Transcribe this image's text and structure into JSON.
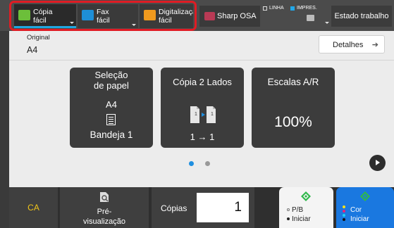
{
  "top_tabs": [
    {
      "label_line1": "Cópia",
      "label_line2": "fácil",
      "icon": "copy-icon"
    },
    {
      "label_line1": "Fax",
      "label_line2": "fácil",
      "icon": "fax-icon"
    },
    {
      "label_line1": "Digitalização",
      "label_line2": "fácil",
      "icon": "scan-icon"
    }
  ],
  "sharp_osa": {
    "label": "Sharp OSA",
    "icon": "osa-icon"
  },
  "status": {
    "line_label": "LINHA",
    "print_label": "IMPRES."
  },
  "job_status_label": "Estado trabalho",
  "original": {
    "label": "Original",
    "value": "A4"
  },
  "details_label": "Detalhes",
  "cards": {
    "paper": {
      "title_line1": "Seleção",
      "title_line2": "de papel",
      "size": "A4",
      "tray": "Bandeja 1"
    },
    "duplex": {
      "title": "Cópia 2 Lados",
      "value": "1 → 1"
    },
    "scale": {
      "title": "Escalas A/R",
      "value": "100%"
    }
  },
  "pagination": {
    "current_page": 1,
    "total_pages": 2
  },
  "bottom": {
    "ca_label": "CA",
    "preview_line1": "Pré-",
    "preview_line2": "visualização",
    "copies_label": "Cópias",
    "copies_value": "1",
    "bw_line1": "P/B",
    "bw_line2": "Iniciar",
    "color_line1": "Cor",
    "color_line2": "Iniciar"
  },
  "colors": {
    "accent_blue": "#1a78e0",
    "highlight_red": "#e01c24",
    "ca_yellow": "#f0c419",
    "start_green": "#2fb84a"
  }
}
